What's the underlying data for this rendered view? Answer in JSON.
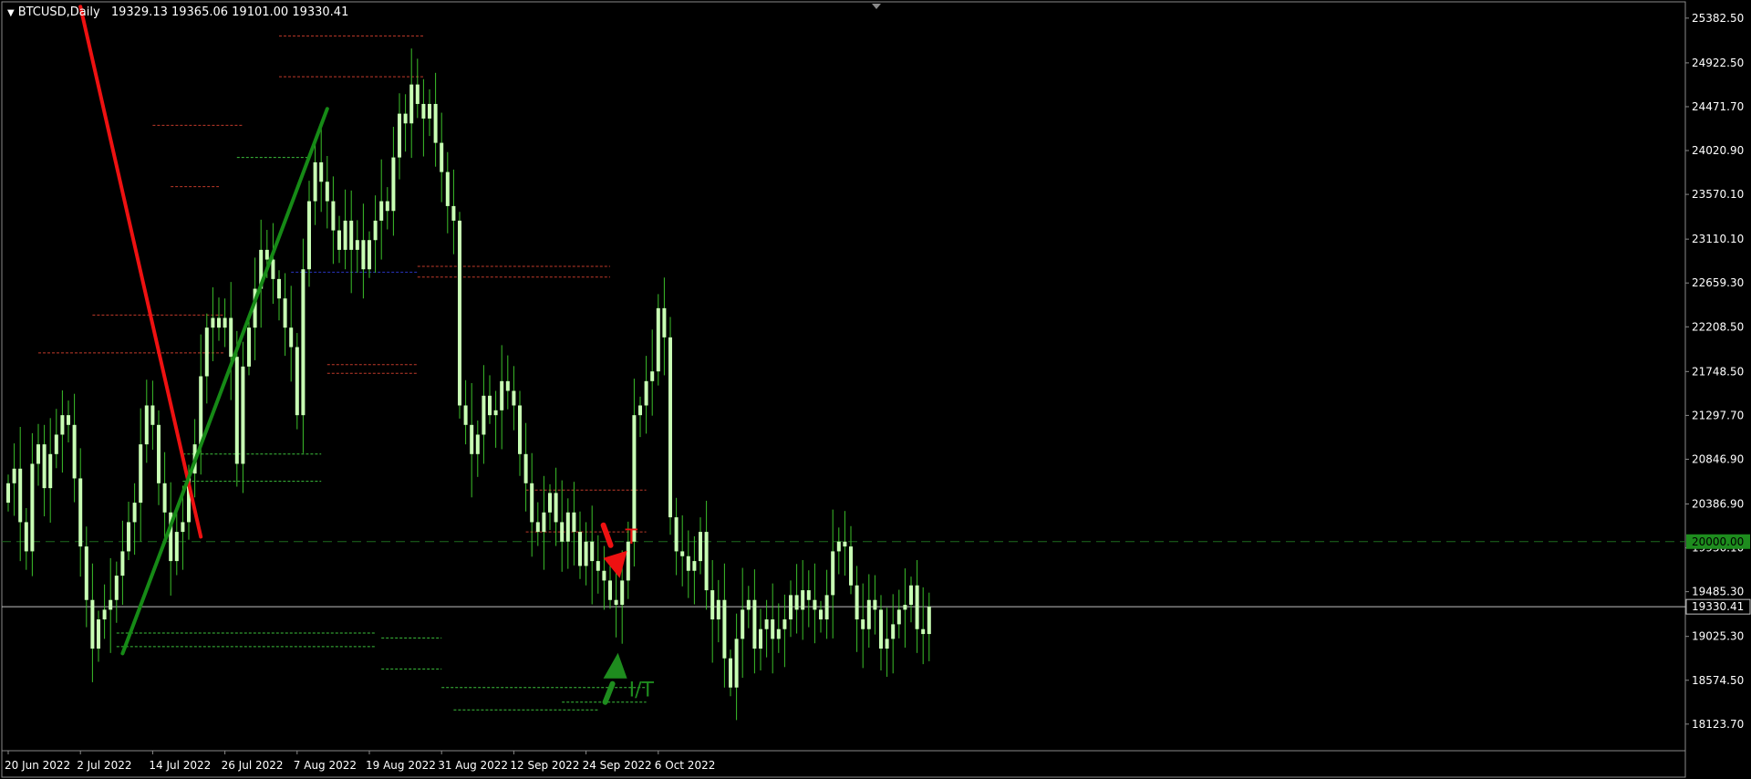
{
  "window": {
    "symbol_label": "BTCUSD,Daily",
    "ohlc_label": "19329.13 19365.06 19101.00 19330.41",
    "current_price_tag": "19330.41",
    "level_tag": "20000.00"
  },
  "colors": {
    "background": "#000000",
    "candle": "#c8ffb4",
    "wick": "#3bbf2a",
    "frame": "#8a8a8a",
    "axis_text": "#ffffff",
    "red_trend": "#ee1111",
    "green_trend": "#168a16",
    "level_line": "#1d6b1d",
    "price_line": "#c0c0c0",
    "res_dotted": "#c03a2a",
    "sup_dotted": "#3cc03c",
    "blue_dotted": "#2a35c0",
    "arrow_red": "#ee1111",
    "arrow_green": "#1e8c1e",
    "level_tag_bg": "#1e8c1e"
  },
  "chart_data": {
    "type": "candlestick",
    "symbol": "BTCUSD",
    "timeframe": "Daily",
    "ylim": [
      17850,
      25550
    ],
    "y_ticks": [
      "25382.50",
      "24922.50",
      "24471.70",
      "24020.90",
      "23570.10",
      "23110.10",
      "22659.30",
      "22208.50",
      "21748.50",
      "21297.70",
      "20846.90",
      "20386.90",
      "19936.10",
      "19485.30",
      "19025.30",
      "18574.50",
      "18123.70"
    ],
    "x_labels": [
      "20 Jun 2022",
      "2 Jul 2022",
      "14 Jul 2022",
      "26 Jul 2022",
      "7 Aug 2022",
      "19 Aug 2022",
      "31 Aug 2022",
      "12 Sep 2022",
      "24 Sep 2022",
      "6 Oct 2022"
    ],
    "close": [
      20600,
      20750,
      20200,
      19900,
      20800,
      21000,
      20550,
      20900,
      21100,
      21300,
      21200,
      20650,
      19950,
      19400,
      18900,
      19200,
      19300,
      19400,
      19650,
      19900,
      20200,
      20400,
      21000,
      21400,
      21200,
      20600,
      20300,
      19800,
      20100,
      20200,
      20700,
      21000,
      21700,
      22200,
      22300,
      22200,
      22300,
      21900,
      20800,
      21800,
      22200,
      22600,
      23000,
      22900,
      22700,
      22500,
      22200,
      22000,
      21300,
      22800,
      23500,
      23900,
      23700,
      23500,
      23200,
      23000,
      23300,
      23000,
      23100,
      22800,
      23100,
      23300,
      23500,
      23400,
      23950,
      24400,
      24300,
      24700,
      24500,
      24350,
      24500,
      24100,
      23800,
      23450,
      23300,
      21400,
      21200,
      20900,
      21100,
      21500,
      21300,
      21350,
      21650,
      21550,
      21400,
      20900,
      20600,
      20200,
      20100,
      20300,
      20500,
      20200,
      20000,
      20300,
      20100,
      19750,
      20000,
      19800,
      19700,
      19600,
      19400,
      19350,
      19600,
      20000,
      21300,
      21400,
      21650,
      21750,
      22400,
      22100,
      20250,
      19900,
      19850,
      19700,
      19800,
      20100,
      19500,
      19200,
      19400,
      18800,
      18500,
      19000,
      19300,
      19400,
      18900,
      19100,
      19200,
      19000,
      19100,
      19200,
      19450,
      19300,
      19500,
      19400,
      19300,
      19200,
      19450,
      19900,
      20000,
      19950,
      19550,
      19200,
      19100,
      19400,
      19300,
      18900,
      19000,
      19150,
      19300,
      19350,
      19550,
      19100,
      19050,
      19330.41
    ],
    "trendlines": [
      {
        "name": "red",
        "color": "#ee1111",
        "from": [
          12,
          25500
        ],
        "to": [
          32,
          20050
        ]
      },
      {
        "name": "green",
        "color": "#168a16",
        "from": [
          19,
          18850
        ],
        "to": [
          53,
          24450
        ]
      }
    ],
    "horizontal_levels": [
      {
        "value": 20000.0,
        "label": "20000.00",
        "style": "dashed"
      },
      {
        "value": 19330.41,
        "label": "19330.41",
        "style": "solid"
      }
    ],
    "annotations": [
      {
        "text": "T",
        "color": "#ee1111",
        "direction": "down",
        "x_index": 101,
        "price": 20000
      },
      {
        "text": "I/T",
        "color": "#1e8c1e",
        "direction": "up",
        "x_index": 101,
        "price": 18500
      }
    ]
  }
}
